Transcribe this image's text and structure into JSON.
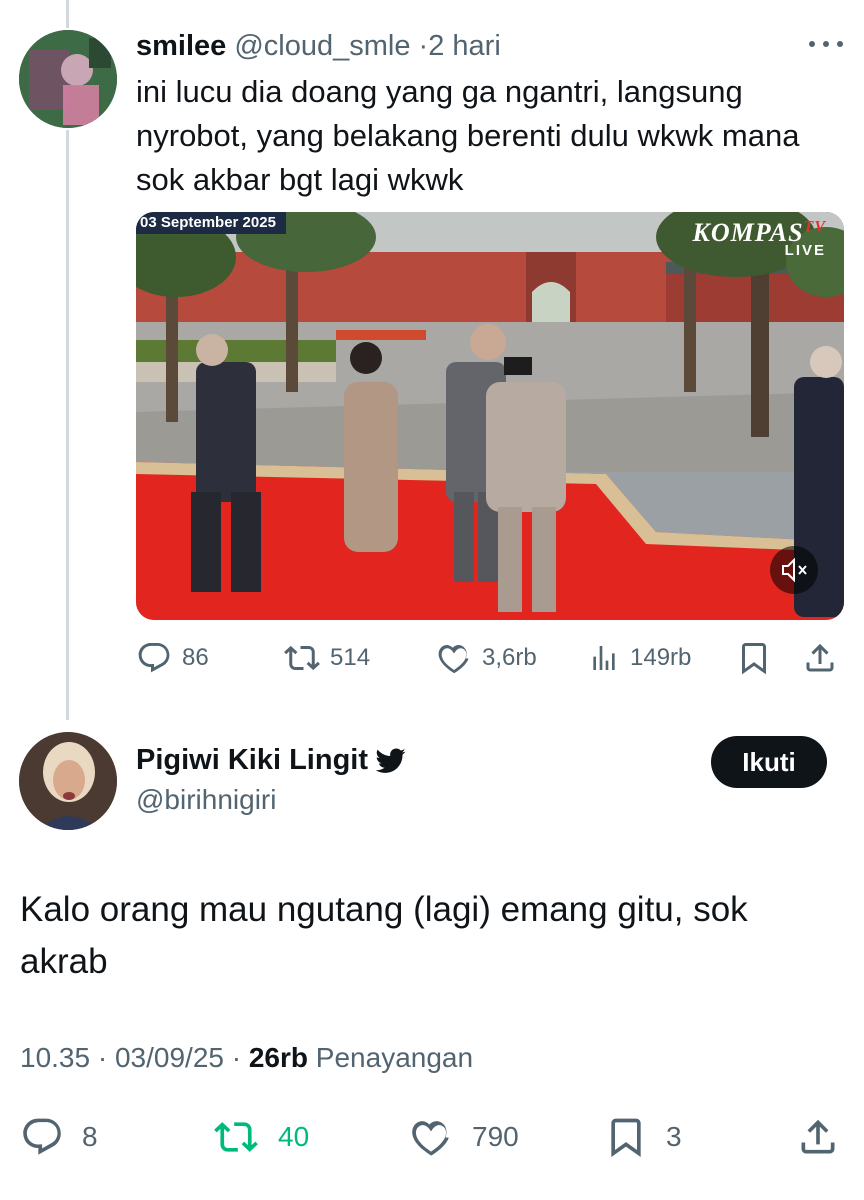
{
  "reply_tweet": {
    "display_name": "smilee",
    "handle": "@cloud_smle",
    "separator": "·",
    "time": "2 hari",
    "text": "ini lucu dia doang yang ga ngantri, langsung nyrobot, yang belakang berenti dulu wkwk mana sok akbar bgt lagi wkwk",
    "media": {
      "date_stamp": "03 September 2025",
      "brand": "KOMPAS",
      "brand_suffix": "TV",
      "live_label": "LIVE"
    },
    "actions": {
      "replies": "86",
      "reposts": "514",
      "likes": "3,6rb",
      "views": "149rb"
    }
  },
  "main_tweet": {
    "display_name": "Pigiwi Kiki Lingit",
    "handle": "@birihnigiri",
    "follow_label": "Ikuti",
    "text": "Kalo orang mau ngutang (lagi) emang gitu, sok akrab",
    "time": "10.35",
    "date": "03/09/25",
    "separator": "·",
    "views_count": "26rb",
    "views_label": "Penayangan",
    "actions": {
      "replies": "8",
      "reposts": "40",
      "likes": "790",
      "bookmarks": "3"
    }
  },
  "colors": {
    "text_primary": "#0f1419",
    "text_secondary": "#536471",
    "repost_active": "#00ba7c",
    "thread_line": "#cfd9de"
  }
}
